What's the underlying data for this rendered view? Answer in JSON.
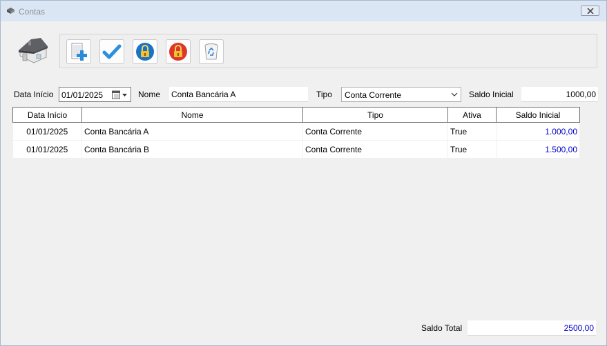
{
  "window": {
    "title": "Contas"
  },
  "form": {
    "data_inicio_label": "Data Início",
    "data_inicio_value": "01/01/2025",
    "nome_label": "Nome",
    "nome_value": "Conta Bancária A",
    "tipo_label": "Tipo",
    "tipo_value": "Conta Corrente",
    "saldo_label": "Saldo Inicial",
    "saldo_value": "1000,00"
  },
  "grid": {
    "columns": [
      "Data Início",
      "Nome",
      "Tipo",
      "Ativa",
      "Saldo Inicial"
    ],
    "rows": [
      [
        "01/01/2025",
        "Conta Bancária A",
        "Conta Corrente",
        "True",
        "1.000,00"
      ],
      [
        "01/01/2025",
        "Conta Bancária B",
        "Conta Corrente",
        "True",
        "1.500,00"
      ]
    ]
  },
  "footer": {
    "saldo_total_label": "Saldo Total",
    "saldo_total_value": "2500,00"
  },
  "toolbar": {
    "icons": [
      "new-document-icon",
      "check-icon",
      "lock-open-icon",
      "lock-closed-icon",
      "recycle-bin-icon"
    ]
  },
  "colors": {
    "value_blue": "#0000cc",
    "title_bg": "#dbe6f4",
    "window_bg": "#f0f0f0"
  }
}
